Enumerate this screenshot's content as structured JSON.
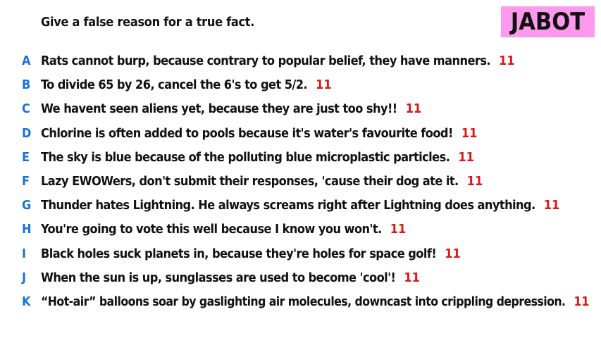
{
  "prompt": "Give a false reason for a true fact.",
  "badge": {
    "label": "JABOT",
    "color": "#ff99ee"
  },
  "colors": {
    "letter": "#1a72d6",
    "count": "#e01515"
  },
  "responses": [
    {
      "letter": "A",
      "text": "Rats cannot burp, because contrary to popular belief, they have manners.",
      "count": "11"
    },
    {
      "letter": "B",
      "text": "To divide 65 by 26, cancel the 6's to get 5/2.",
      "count": "11"
    },
    {
      "letter": "C",
      "text": "We havent seen aliens yet, because they are just too shy!!",
      "count": "11"
    },
    {
      "letter": "D",
      "text": "Chlorine is often added to pools because it's water's favourite food!",
      "count": "11"
    },
    {
      "letter": "E",
      "text": "The sky is blue because of the polluting blue microplastic particles.",
      "count": "11"
    },
    {
      "letter": "F",
      "text": "Lazy EWOWers, don't submit their responses, 'cause their dog ate it.",
      "count": "11"
    },
    {
      "letter": "G",
      "text": "Thunder hates Lightning. He always screams right after Lightning does anything.",
      "count": "11"
    },
    {
      "letter": "H",
      "text": "You're going to vote this well because I know you won't.",
      "count": "11"
    },
    {
      "letter": "I",
      "text": "Black holes suck planets in, because they're holes for space golf!",
      "count": "11"
    },
    {
      "letter": "J",
      "text": "When the sun is up, sunglasses are used to become 'cool'!",
      "count": "11"
    },
    {
      "letter": "K",
      "text": "“Hot-air” balloons soar by gaslighting air molecules, downcast into crippling depression.",
      "count": "11"
    }
  ]
}
